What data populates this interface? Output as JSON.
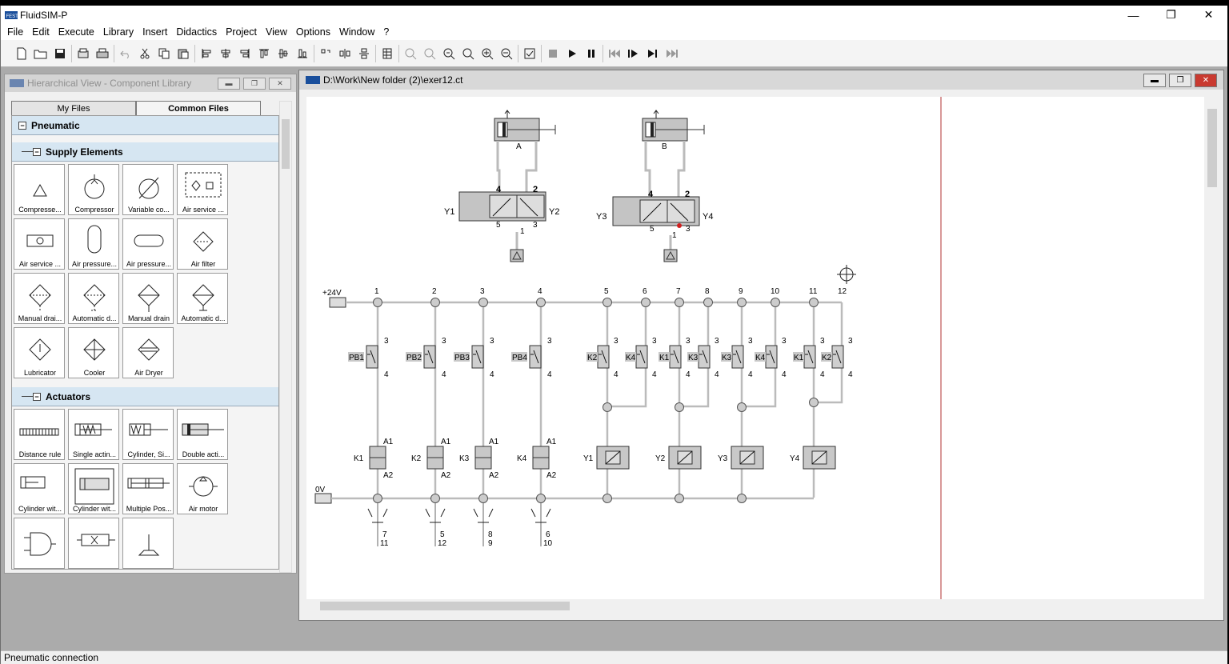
{
  "window": {
    "title": "FluidSIM-P",
    "minimize": "—",
    "restore": "❐",
    "close": "✕"
  },
  "menu": [
    "File",
    "Edit",
    "Execute",
    "Library",
    "Insert",
    "Didactics",
    "Project",
    "View",
    "Options",
    "Window",
    "?"
  ],
  "library_panel": {
    "title": "Hierarchical View - Component Library",
    "tabs": [
      "My Files",
      "Common Files"
    ],
    "active_tab": "Common Files",
    "categories": [
      {
        "label": "Pneumatic"
      },
      {
        "label": "Supply Elements",
        "items": [
          "Compresse...",
          "Compressor",
          "Variable co...",
          "Air service ...",
          "Air service ...",
          "Air pressure...",
          "Air pressure...",
          "Air filter",
          "Manual drai...",
          "Automatic d...",
          "Manual drain",
          "Automatic d...",
          "Lubricator",
          "Cooler",
          "Air Dryer"
        ]
      },
      {
        "label": "Actuators",
        "items": [
          "Distance rule",
          "Single actin...",
          "Cylinder, Si...",
          "Double acti...",
          "Cylinder wit...",
          "Cylinder wit...",
          "Multiple Pos...",
          "Air motor",
          "",
          "",
          ""
        ]
      }
    ]
  },
  "circuit_window": {
    "title": "D:\\Work\\New folder (2)\\exer12.ct"
  },
  "circuit": {
    "cylinders": [
      "A",
      "B"
    ],
    "valve1": {
      "left": "Y1",
      "right": "Y2",
      "ports": [
        "4",
        "2",
        "5",
        "1",
        "3"
      ]
    },
    "valve2": {
      "left": "Y3",
      "right": "Y4",
      "ports": [
        "4",
        "2",
        "5",
        "1",
        "3"
      ]
    },
    "supply_pos": "+24V",
    "supply_neg": "0V",
    "rungs": [
      "1",
      "2",
      "3",
      "4",
      "5",
      "6",
      "7",
      "8",
      "9",
      "10",
      "11",
      "12"
    ],
    "contacts": [
      "PB1",
      "PB2",
      "PB3",
      "PB4",
      "K2",
      "K4",
      "K1",
      "K3",
      "K3",
      "K4",
      "K1",
      "K2"
    ],
    "relays": [
      "K1",
      "K2",
      "K3",
      "K4"
    ],
    "solenoids": [
      "Y1",
      "Y2",
      "Y3",
      "Y4"
    ],
    "contact_top": "3",
    "contact_bottom": "4",
    "relay_top": "A1",
    "relay_bottom": "A2",
    "relay_contacts": [
      [
        "7",
        "11"
      ],
      [
        "5",
        "12"
      ],
      [
        "8",
        "9"
      ],
      [
        "6",
        "10"
      ]
    ]
  },
  "status": "Pneumatic connection"
}
